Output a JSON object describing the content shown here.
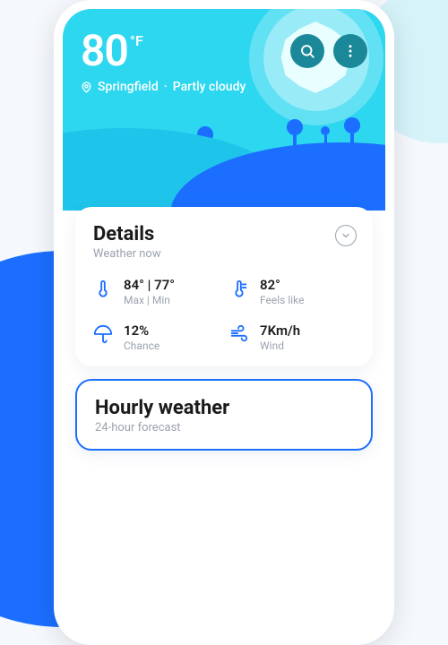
{
  "header": {
    "temperature": "80",
    "unit": "°F",
    "location": "Springfield",
    "condition": "Partly cloudy",
    "separator": " · "
  },
  "details": {
    "title": "Details",
    "subtitle": "Weather now",
    "metrics": {
      "maxmin": {
        "value": "84° | 77°",
        "label": "Max | Min"
      },
      "feels": {
        "value": "82°",
        "label": "Feels like"
      },
      "chance": {
        "value": "12%",
        "label": "Chance"
      },
      "wind": {
        "value": "7Km/h",
        "label": "Wind"
      }
    }
  },
  "hourly": {
    "title": "Hourly weather",
    "subtitle": "24-hour forecast"
  },
  "colors": {
    "accent": "#1b6eff",
    "sky": "#2cd7ef"
  }
}
